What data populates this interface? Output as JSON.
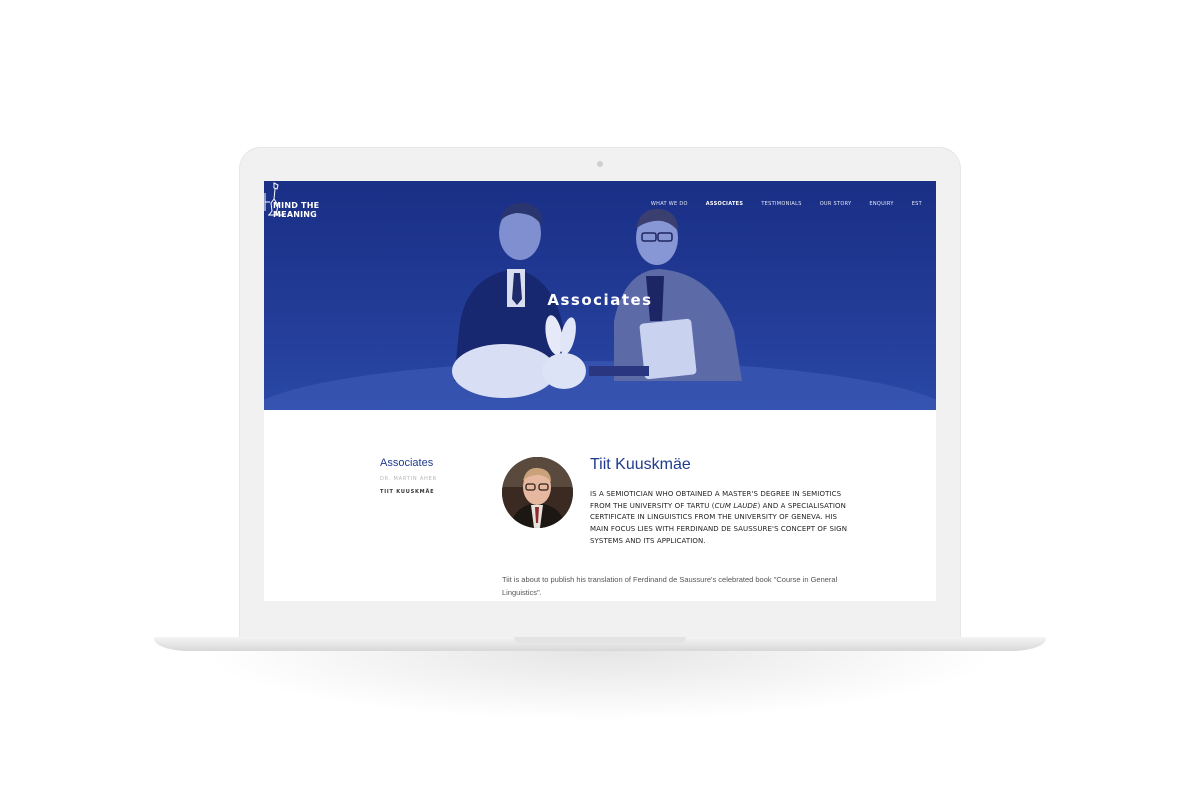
{
  "site": {
    "logo_line1": "MIND THE",
    "logo_line2": "MEANING"
  },
  "nav": {
    "items": [
      "WHAT WE DO",
      "ASSOCIATES",
      "TESTIMONIALS",
      "OUR STORY",
      "ENQUIRY",
      "EST"
    ],
    "active": "ASSOCIATES"
  },
  "hero": {
    "title": "Associates"
  },
  "sidebar": {
    "title": "Associates",
    "items": [
      "DR. MARTIN AHER",
      "TIIT KUUSKMÄE"
    ]
  },
  "profile": {
    "name": "Tiit Kuuskmäe",
    "bio_part1": "IS A SEMIOTICIAN WHO OBTAINED A MASTER'S DEGREE IN SEMIOTICS FROM THE UNIVERSITY OF TARTU (",
    "bio_italic": "CUM LAUDE",
    "bio_part2": ") AND A SPECIALISATION CERTIFICATE IN LINGUISTICS FROM THE UNIVERSITY OF GENEVA. HIS MAIN FOCUS LIES WITH FERDINAND DE SAUSSURE'S CONCEPT OF SIGN SYSTEMS AND ITS APPLICATION.",
    "paragraph": "Tiit is about to publish his translation of Ferdinand de Saussure's celebrated book \"Course in General Linguistics\"."
  },
  "colors": {
    "brand_blue": "#1f3b8f",
    "hero_blue": "#213a94"
  }
}
